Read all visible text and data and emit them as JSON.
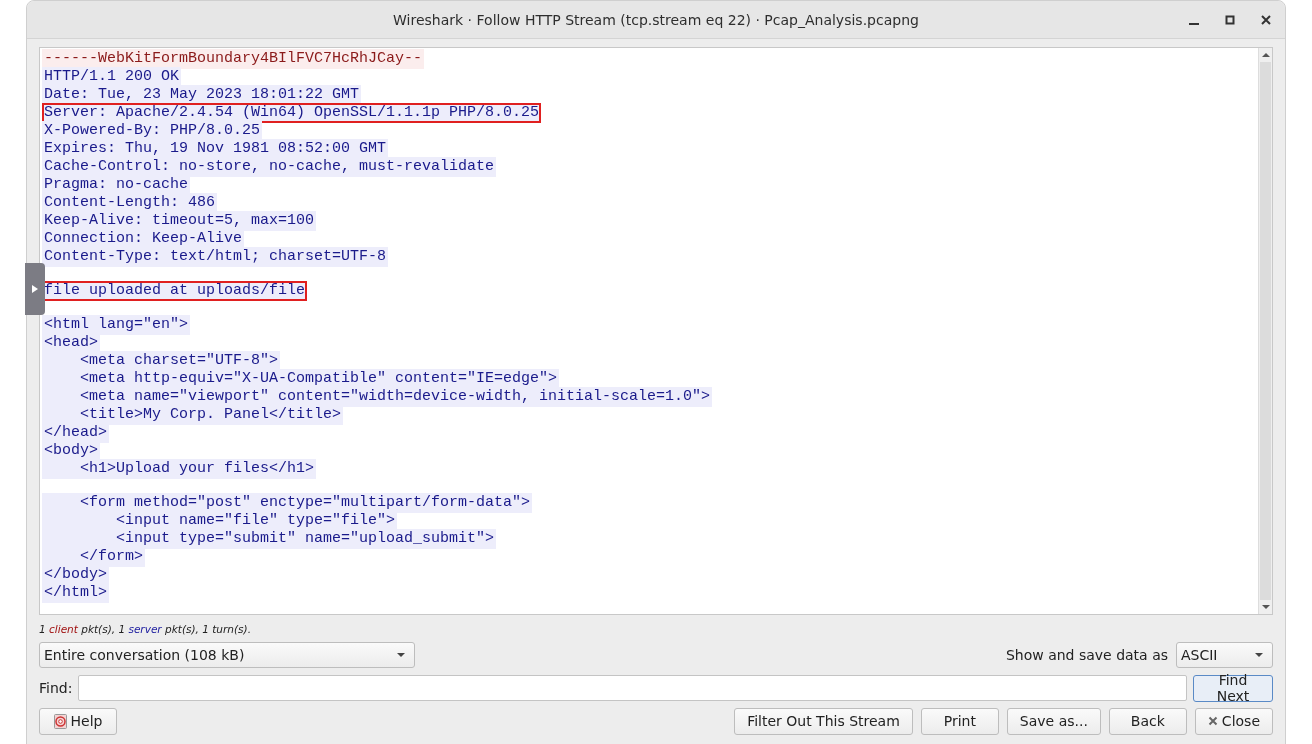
{
  "window": {
    "title": "Wireshark · Follow HTTP Stream (tcp.stream eq 22) · Pcap_Analysis.pcapng"
  },
  "stream": {
    "lines": [
      {
        "kind": "client",
        "text": "------WebKitFormBoundary4BIlFVC7HcRhJCay--",
        "outlined": false
      },
      {
        "kind": "server",
        "text": "HTTP/1.1 200 OK",
        "outlined": false
      },
      {
        "kind": "server",
        "text": "Date: Tue, 23 May 2023 18:01:22 GMT",
        "outlined": false
      },
      {
        "kind": "server",
        "text": "Server: Apache/2.4.54 (Win64) OpenSSL/1.1.1p PHP/8.0.25",
        "outlined": true
      },
      {
        "kind": "server",
        "text": "X-Powered-By: PHP/8.0.25",
        "outlined": false
      },
      {
        "kind": "server",
        "text": "Expires: Thu, 19 Nov 1981 08:52:00 GMT",
        "outlined": false
      },
      {
        "kind": "server",
        "text": "Cache-Control: no-store, no-cache, must-revalidate",
        "outlined": false
      },
      {
        "kind": "server",
        "text": "Pragma: no-cache",
        "outlined": false
      },
      {
        "kind": "server",
        "text": "Content-Length: 486",
        "outlined": false
      },
      {
        "kind": "server",
        "text": "Keep-Alive: timeout=5, max=100",
        "outlined": false
      },
      {
        "kind": "server",
        "text": "Connection: Keep-Alive",
        "outlined": false
      },
      {
        "kind": "server",
        "text": "Content-Type: text/html; charset=UTF-8",
        "outlined": false
      },
      {
        "kind": "blank"
      },
      {
        "kind": "server",
        "text": "file uploaded at uploads/file",
        "outlined": true
      },
      {
        "kind": "blank"
      },
      {
        "kind": "server",
        "text": "<html lang=\"en\">",
        "outlined": false
      },
      {
        "kind": "server",
        "text": "<head>",
        "outlined": false
      },
      {
        "kind": "server",
        "text": "    <meta charset=\"UTF-8\">",
        "outlined": false
      },
      {
        "kind": "server",
        "text": "    <meta http-equiv=\"X-UA-Compatible\" content=\"IE=edge\">",
        "outlined": false
      },
      {
        "kind": "server",
        "text": "    <meta name=\"viewport\" content=\"width=device-width, initial-scale=1.0\">",
        "outlined": false
      },
      {
        "kind": "server",
        "text": "    <title>My Corp. Panel</title>",
        "outlined": false
      },
      {
        "kind": "server",
        "text": "</head>",
        "outlined": false
      },
      {
        "kind": "server",
        "text": "<body>",
        "outlined": false
      },
      {
        "kind": "server",
        "text": "    <h1>Upload your files</h1>",
        "outlined": false
      },
      {
        "kind": "blank"
      },
      {
        "kind": "server",
        "text": "    <form method=\"post\" enctype=\"multipart/form-data\">",
        "outlined": false
      },
      {
        "kind": "server",
        "text": "        <input name=\"file\" type=\"file\">",
        "outlined": false
      },
      {
        "kind": "server",
        "text": "        <input type=\"submit\" name=\"upload_submit\">",
        "outlined": false
      },
      {
        "kind": "server",
        "text": "    </form>",
        "outlined": false
      },
      {
        "kind": "server",
        "text": "</body>",
        "outlined": false
      },
      {
        "kind": "server",
        "text": "</html>",
        "outlined": false
      }
    ]
  },
  "summary": [
    {
      "kind": "plain",
      "text": "1 "
    },
    {
      "kind": "client",
      "text": "client"
    },
    {
      "kind": "plain",
      "text": " pkt(s), 1 "
    },
    {
      "kind": "server",
      "text": "server"
    },
    {
      "kind": "plain",
      "text": " pkt(s), 1 turn(s)."
    }
  ],
  "conversation": {
    "value": "Entire conversation (108 kB)"
  },
  "format": {
    "label": "Show and save data as",
    "value": "ASCII"
  },
  "find": {
    "label": "Find:",
    "button": "Find Next",
    "focused": true
  },
  "buttons": [
    {
      "kind": "help",
      "label": "Help"
    },
    {
      "kind": "spacer"
    },
    {
      "kind": "plain",
      "label": "Filter Out This Stream"
    },
    {
      "kind": "plain",
      "label": "Print"
    },
    {
      "kind": "plain",
      "label": "Save as..."
    },
    {
      "kind": "plain",
      "label": "Back"
    },
    {
      "kind": "close",
      "label": "Close"
    }
  ]
}
